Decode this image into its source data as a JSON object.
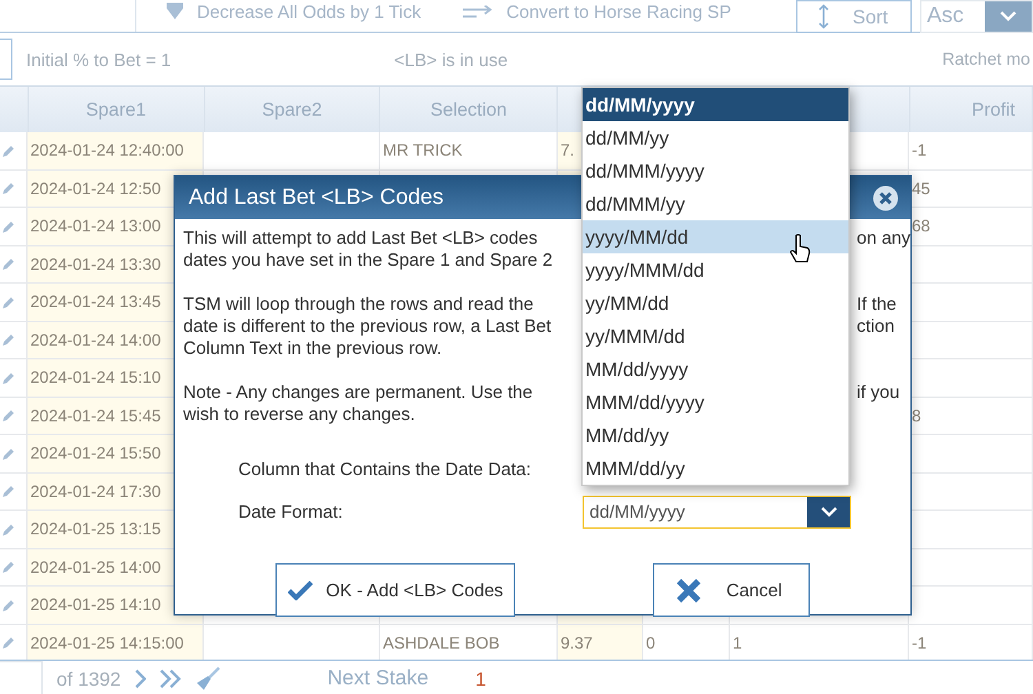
{
  "toolbar": {
    "actions": [
      {
        "label": "Decrease All Odds by 1 Tick",
        "kind": "down"
      },
      {
        "label": "Convert to Horse Racing SP",
        "kind": "arrows"
      }
    ],
    "sort_button": "Sort",
    "order_select": {
      "value": "Asc"
    }
  },
  "info_bar": {
    "initial": "Initial % to Bet = 1",
    "lb_status": "<LB> is in use",
    "ratchet": "Ratchet mo"
  },
  "table": {
    "columns": [
      "",
      "Spare1",
      "Spare2",
      "Selection",
      "",
      "",
      "",
      "Profit"
    ],
    "rows": [
      [
        "",
        "2024-01-24 12:40:00",
        "",
        "MR TRICK",
        "7.",
        "",
        "",
        "-1"
      ],
      [
        "",
        "2024-01-24 12:50",
        "",
        "",
        "",
        "",
        "",
        "45"
      ],
      [
        "",
        "2024-01-24 13:00",
        "",
        "",
        "",
        "",
        "",
        "68"
      ],
      [
        "",
        "2024-01-24 13:30",
        "",
        "",
        "",
        "",
        "",
        ""
      ],
      [
        "",
        "2024-01-24 13:45",
        "",
        "",
        "",
        "",
        "",
        ""
      ],
      [
        "",
        "2024-01-24 14:00",
        "",
        "",
        "",
        "",
        "",
        ""
      ],
      [
        "",
        "2024-01-24 15:10",
        "",
        "",
        "",
        "",
        "",
        ""
      ],
      [
        "",
        "2024-01-24 15:45",
        "",
        "",
        "",
        "",
        "",
        "8"
      ],
      [
        "",
        "2024-01-24 15:50",
        "",
        "",
        "",
        "",
        "",
        ""
      ],
      [
        "",
        "2024-01-24 17:30",
        "",
        "",
        "",
        "",
        "",
        ""
      ],
      [
        "",
        "2024-01-25 13:15",
        "",
        "",
        "",
        "",
        "",
        ""
      ],
      [
        "",
        "2024-01-25 14:00",
        "",
        "",
        "",
        "",
        "",
        ""
      ],
      [
        "",
        "2024-01-25 14:10",
        "",
        "",
        "",
        "",
        "",
        ""
      ],
      [
        "",
        "2024-01-25 14:15:00",
        "",
        "ASHDALE BOB",
        "9.37",
        "0",
        "1",
        "-1"
      ]
    ]
  },
  "footer": {
    "page_of": "of 1392",
    "next_stake_label": "Next Stake",
    "next_stake": "1"
  },
  "dialog": {
    "title": "Add Last Bet <LB> Codes",
    "paragraphs": [
      [
        {
          "left": "This will attempt to add Last Bet <LB> codes",
          "right": "on any"
        },
        {
          "left": "dates you have set in the Spare 1 and Spare 2"
        }
      ],
      [
        {
          "left": "TSM will loop through the rows and read the",
          "right": "If the"
        },
        {
          "left": "date is different to the previous row, a Last Bet",
          "right": "ction"
        },
        {
          "left": "Column Text in the previous row."
        }
      ],
      [
        {
          "left": "Note - Any changes are permanent. Use the",
          "right": "if you"
        },
        {
          "left": "wish to reverse any changes."
        }
      ]
    ],
    "column_label": "Column that Contains the Date Data:",
    "date_format_label": "Date Format:",
    "date_format_value": "dd/MM/yyyy",
    "ok_button": "OK - Add <LB> Codes",
    "cancel_button": "Cancel"
  },
  "date_format_options": [
    {
      "label": "dd/MM/yyyy",
      "selected": true,
      "hovered": false
    },
    {
      "label": "dd/MM/yy",
      "selected": false,
      "hovered": false
    },
    {
      "label": "dd/MMM/yyyy",
      "selected": false,
      "hovered": false
    },
    {
      "label": "dd/MMM/yy",
      "selected": false,
      "hovered": false
    },
    {
      "label": "yyyy/MM/dd",
      "selected": false,
      "hovered": true
    },
    {
      "label": "yyyy/MMM/dd",
      "selected": false,
      "hovered": false
    },
    {
      "label": "yy/MM/dd",
      "selected": false,
      "hovered": false
    },
    {
      "label": "yy/MMM/dd",
      "selected": false,
      "hovered": false
    },
    {
      "label": "MM/dd/yyyy",
      "selected": false,
      "hovered": false
    },
    {
      "label": "MMM/dd/yyyy",
      "selected": false,
      "hovered": false
    },
    {
      "label": "MM/dd/yy",
      "selected": false,
      "hovered": false
    },
    {
      "label": "MMM/dd/yy",
      "selected": false,
      "hovered": false
    }
  ]
}
